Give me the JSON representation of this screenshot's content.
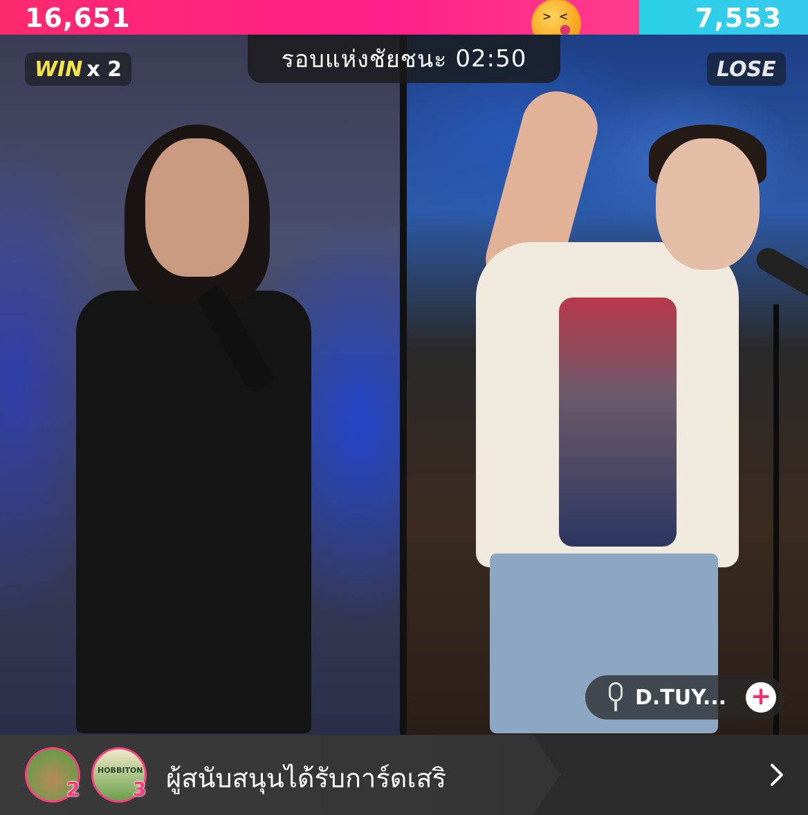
{
  "score": {
    "left": "16,651",
    "right": "7,553",
    "left_share": 0.688
  },
  "round": {
    "label": "รอบแห่งชัยชนะ",
    "time": "02:50"
  },
  "left_panel": {
    "win_label": "WIN",
    "win_multiplier": "x 2"
  },
  "right_panel": {
    "result_label": "LOSE",
    "host_name": "D.TUY...",
    "follow_icon": "+"
  },
  "banner": {
    "text": "ผู้สนับสนุนได้รับการ์ดเสริ",
    "supporters": [
      {
        "rank": "2"
      },
      {
        "rank": "3",
        "avatar_text": "HOBBITON"
      }
    ]
  },
  "colors": {
    "left": "#ff1f8a",
    "right": "#38c9ee",
    "rank": "#ff3d7f"
  }
}
